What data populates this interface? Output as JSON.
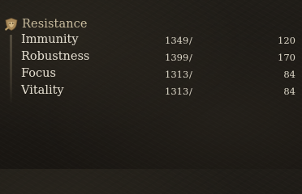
{
  "section": {
    "title": "Resistance",
    "icon": "shield-helmet-icon"
  },
  "rows": [
    {
      "name": "Immunity",
      "value": "1349",
      "separator": "/",
      "requirement": "120"
    },
    {
      "name": "Robustness",
      "value": "1399",
      "separator": "/",
      "requirement": "170"
    },
    {
      "name": "Focus",
      "value": "1313",
      "separator": "/",
      "requirement": "84"
    },
    {
      "name": "Vitality",
      "value": "1313",
      "separator": "/",
      "requirement": "84"
    }
  ],
  "colors": {
    "title": "#c9bc9e",
    "text": "#e6e0d2",
    "background": "#1c1915"
  }
}
